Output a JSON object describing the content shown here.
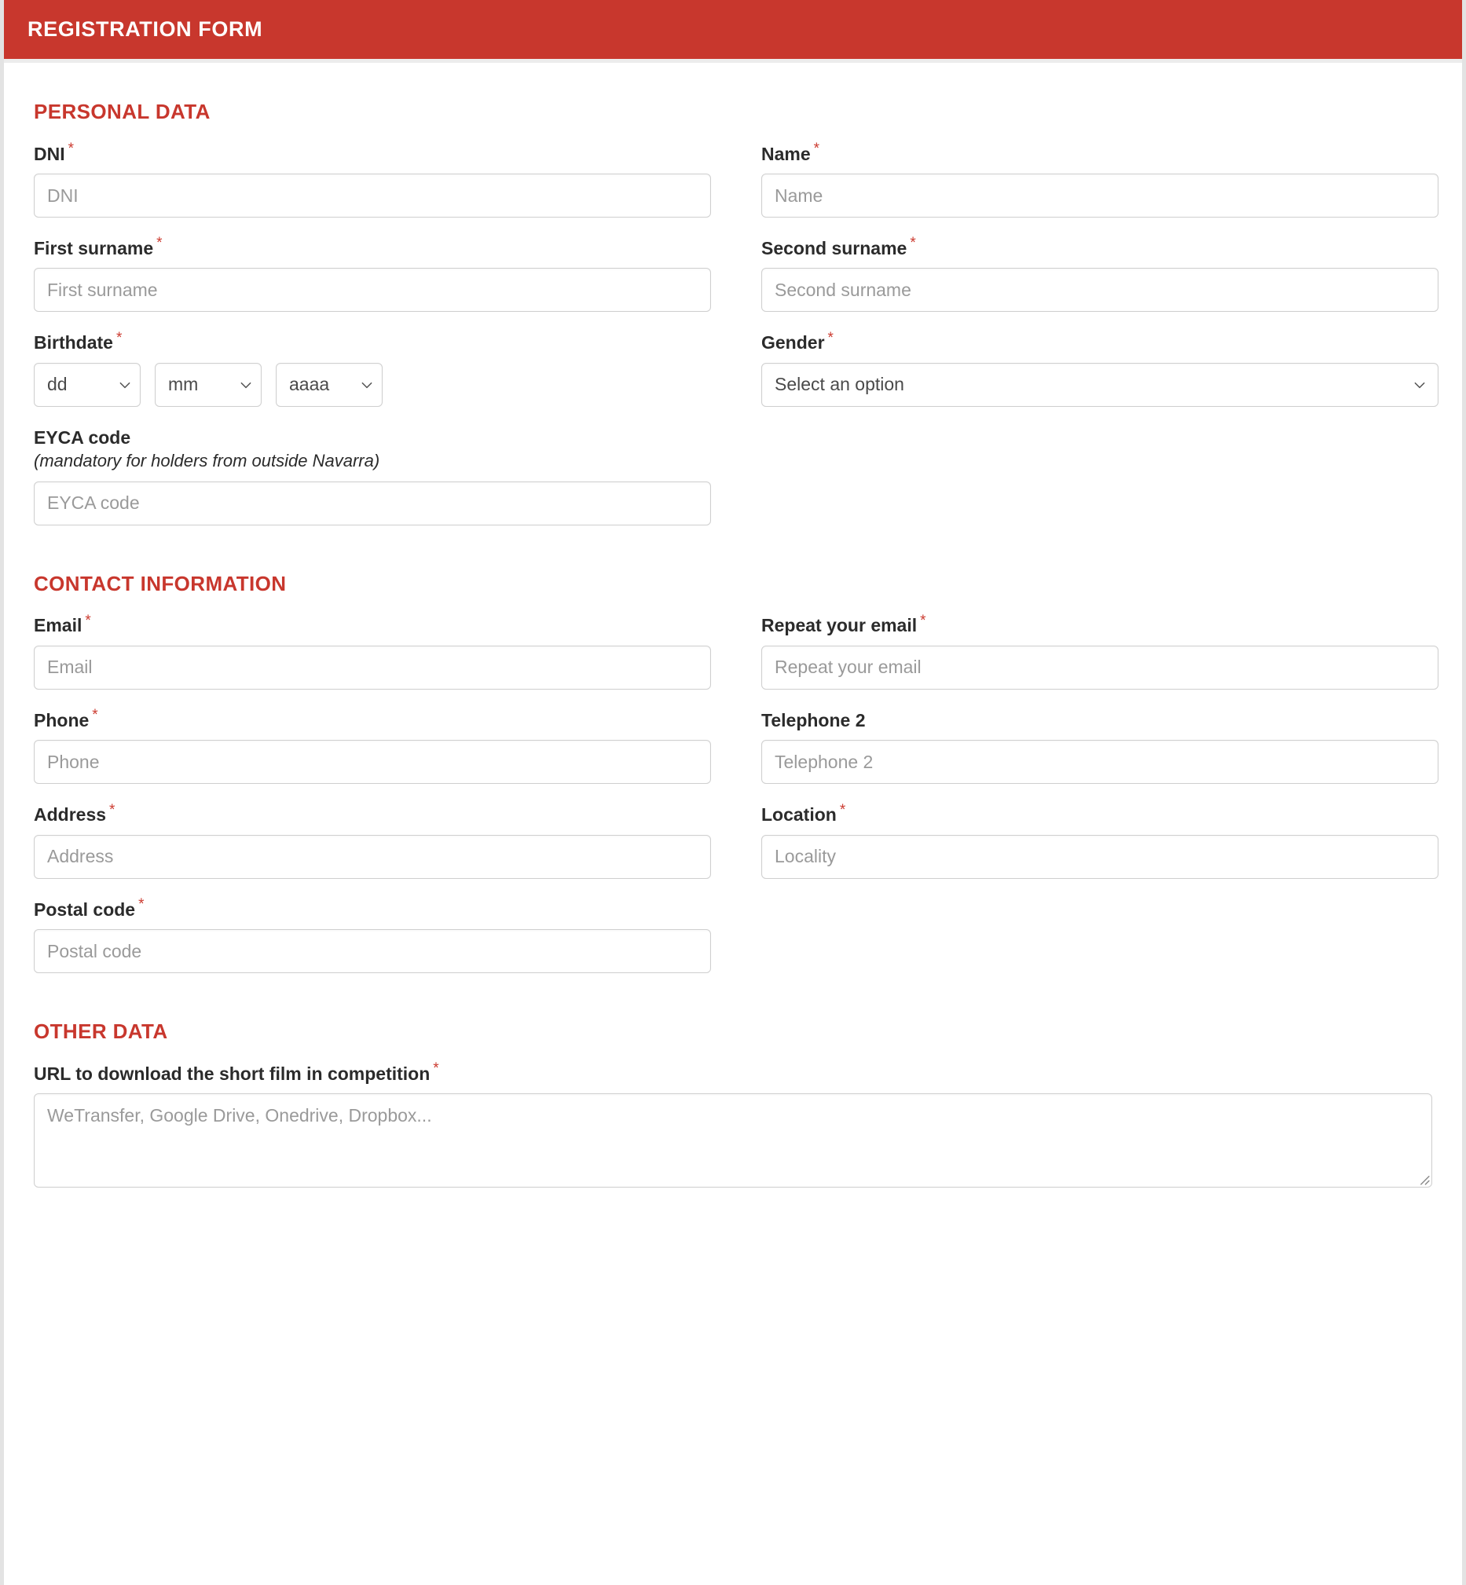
{
  "header": {
    "title": "REGISTRATION FORM",
    "accent_color": "#c8372d",
    "text_color": "#ffffff"
  },
  "required_marker": "*",
  "sections": {
    "personal": {
      "title": "PERSONAL DATA",
      "fields": {
        "dni": {
          "label": "DNI",
          "placeholder": "DNI",
          "required": true
        },
        "name": {
          "label": "Name",
          "placeholder": "Name",
          "required": true
        },
        "first_surname": {
          "label": "First surname",
          "placeholder": "First surname",
          "required": true
        },
        "second_surname": {
          "label": "Second surname",
          "placeholder": "Second surname",
          "required": true
        },
        "birthdate": {
          "label": "Birthdate",
          "required": true,
          "day": "dd",
          "month": "mm",
          "year": "aaaa"
        },
        "gender": {
          "label": "Gender",
          "required": true,
          "selected": "Select an option"
        },
        "eyca": {
          "label": "EYCA code",
          "note": "(mandatory for holders from outside Navarra)",
          "placeholder": "EYCA code",
          "required": false
        }
      }
    },
    "contact": {
      "title": "CONTACT INFORMATION",
      "fields": {
        "email": {
          "label": "Email",
          "placeholder": "Email",
          "required": true
        },
        "repeat_email": {
          "label": "Repeat your email",
          "placeholder": "Repeat your email",
          "required": true
        },
        "phone": {
          "label": "Phone",
          "placeholder": "Phone",
          "required": true
        },
        "telephone2": {
          "label": "Telephone 2",
          "placeholder": "Telephone 2",
          "required": false
        },
        "address": {
          "label": "Address",
          "placeholder": "Address",
          "required": true
        },
        "location": {
          "label": "Location",
          "placeholder": "Locality",
          "required": true
        },
        "postal_code": {
          "label": "Postal code",
          "placeholder": "Postal code",
          "required": true
        }
      }
    },
    "other": {
      "title": "OTHER DATA",
      "fields": {
        "film_url": {
          "label": "URL to download the short film in competition",
          "placeholder": "WeTransfer, Google Drive, Onedrive, Dropbox...",
          "required": true
        }
      }
    }
  },
  "icons": {
    "chevron_down": "chevron-down-icon",
    "resize_grip": "resize-grip-icon"
  }
}
